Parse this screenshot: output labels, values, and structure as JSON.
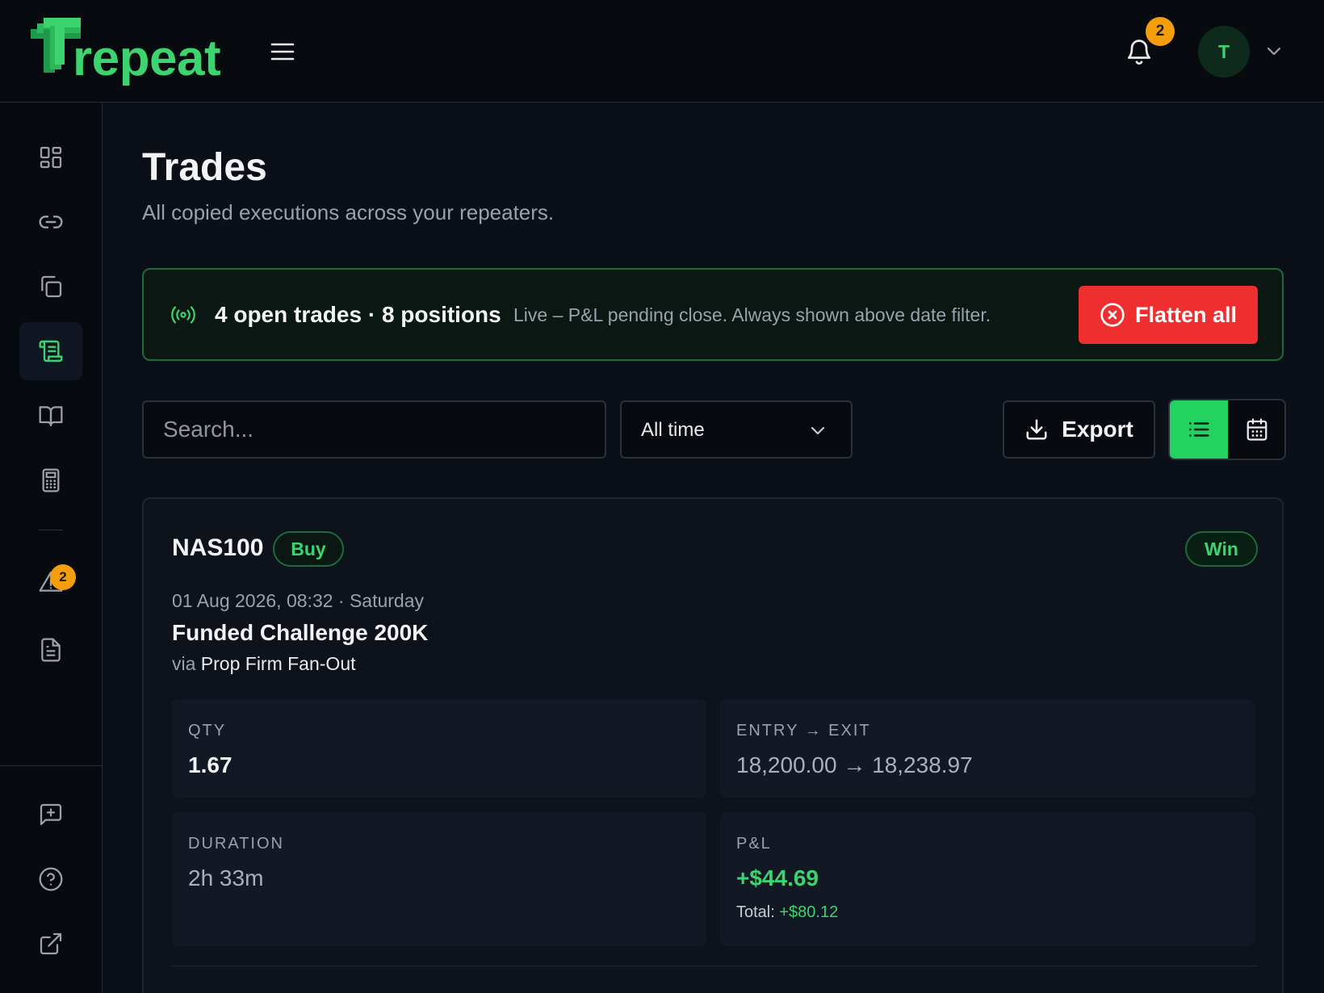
{
  "header": {
    "logo_text": "repeat",
    "notifications_count": "2",
    "avatar_initial": "T"
  },
  "sidebar": {
    "items": [
      {
        "icon": "dashboard-icon"
      },
      {
        "icon": "link-icon"
      },
      {
        "icon": "copy-icon"
      },
      {
        "icon": "scroll-icon",
        "active": true
      },
      {
        "icon": "book-icon"
      },
      {
        "icon": "calculator-icon"
      },
      {
        "icon": "warning-icon",
        "badge": "2"
      },
      {
        "icon": "document-icon"
      },
      {
        "icon": "feedback-icon"
      },
      {
        "icon": "help-icon"
      },
      {
        "icon": "external-link-icon"
      }
    ]
  },
  "page": {
    "title": "Trades",
    "subtitle": "All copied executions across your repeaters."
  },
  "banner": {
    "title": "4 open trades · 8 positions",
    "note": "Live – P&L pending close. Always shown above date filter.",
    "flatten_label": "Flatten all"
  },
  "filters": {
    "search_placeholder": "Search...",
    "date_range": "All time",
    "export_label": "Export"
  },
  "colors": {
    "accent": "#3dd46f",
    "danger": "#ef2f2f",
    "badge": "#f59e0b",
    "background": "#0b0f17"
  },
  "trade": {
    "symbol": "NAS100",
    "side": "Buy",
    "result": "Win",
    "date": "01 Aug 2026, 08:32 · Saturday",
    "account": "Funded Challenge 200K",
    "via_prefix": "via",
    "via_name": "Prop Firm Fan-Out",
    "qty_label": "QTY",
    "qty": "1.67",
    "entry_exit_label": "ENTRY → EXIT",
    "entry_exit": "18,200.00 → 18,238.97",
    "duration_label": "DURATION",
    "duration": "2h 33m",
    "pnl_label": "P&L",
    "pnl": "+$44.69",
    "total_label": "Total:",
    "total": "+$80.12"
  }
}
